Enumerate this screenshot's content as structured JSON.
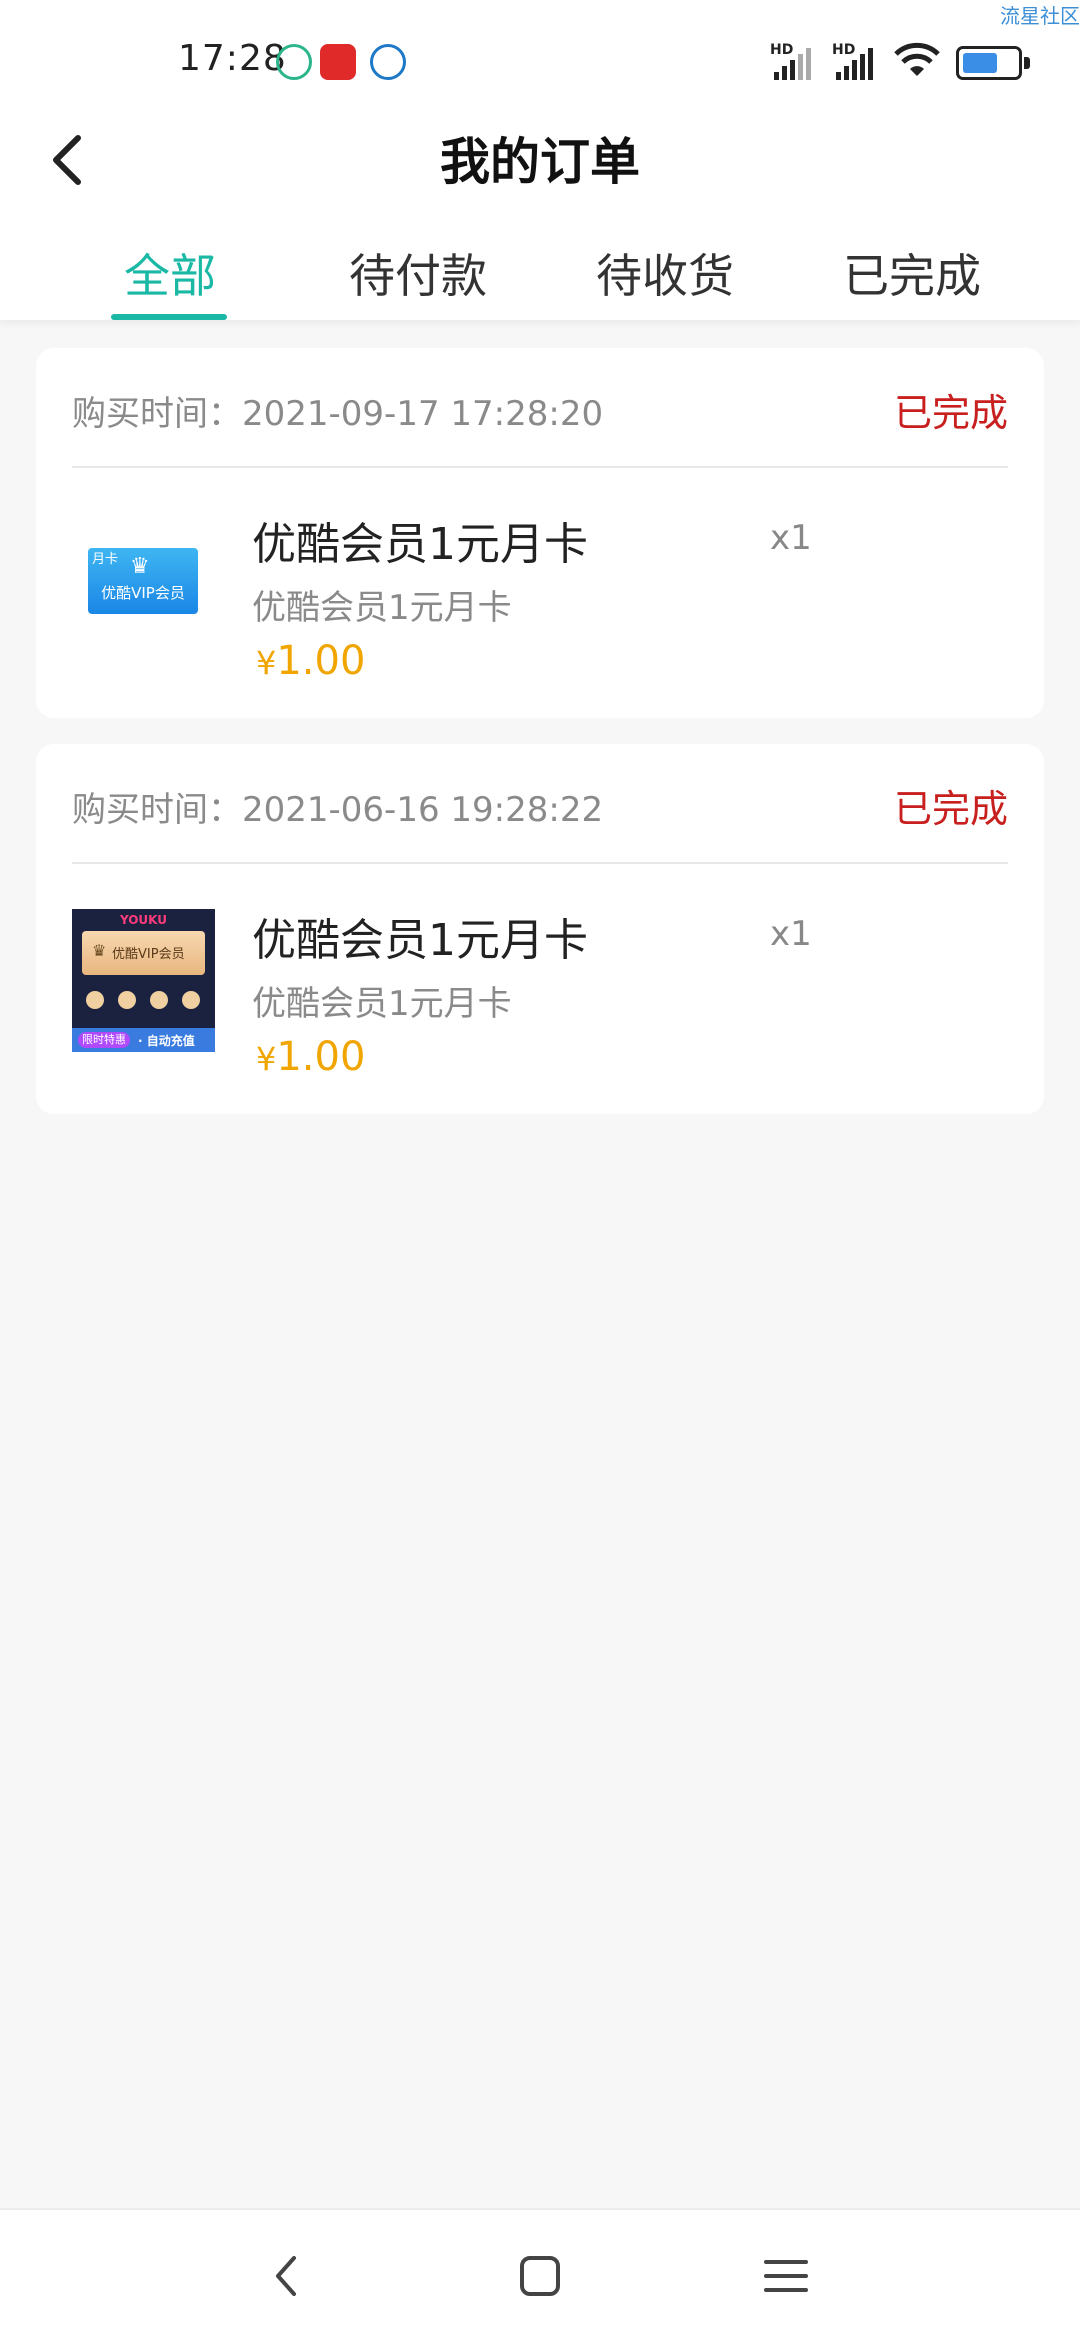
{
  "status_bar": {
    "time": "17:28",
    "network_type_1": "HD",
    "network_type_2": "HD",
    "watermark": "流星社区"
  },
  "header": {
    "title": "我的订单"
  },
  "tabs": [
    {
      "label": "全部",
      "active": true
    },
    {
      "label": "待付款",
      "active": false
    },
    {
      "label": "待收货",
      "active": false
    },
    {
      "label": "已完成",
      "active": false
    }
  ],
  "orders": [
    {
      "time_label": "购买时间：2021-09-17 17:28:20",
      "status": "已完成",
      "product_name": "优酷会员1元月卡",
      "product_sub": "优酷会员1元月卡",
      "currency": "¥",
      "price": "1.00",
      "quantity": "x1",
      "thumb_tag": "月卡",
      "thumb_label": "优酷VIP会员"
    },
    {
      "time_label": "购买时间：2021-06-16 19:28:22",
      "status": "已完成",
      "product_name": "优酷会员1元月卡",
      "product_sub": "优酷会员1元月卡",
      "currency": "¥",
      "price": "1.00",
      "quantity": "x1",
      "thumb_brand": "YOUKU",
      "thumb_label": "优酷VIP会员",
      "thumb_banner_tag": "限时特惠",
      "thumb_banner_text": "· 自动充值"
    }
  ],
  "colors": {
    "accent": "#1bb9a5",
    "status": "#c8201e",
    "price": "#f0a500"
  }
}
